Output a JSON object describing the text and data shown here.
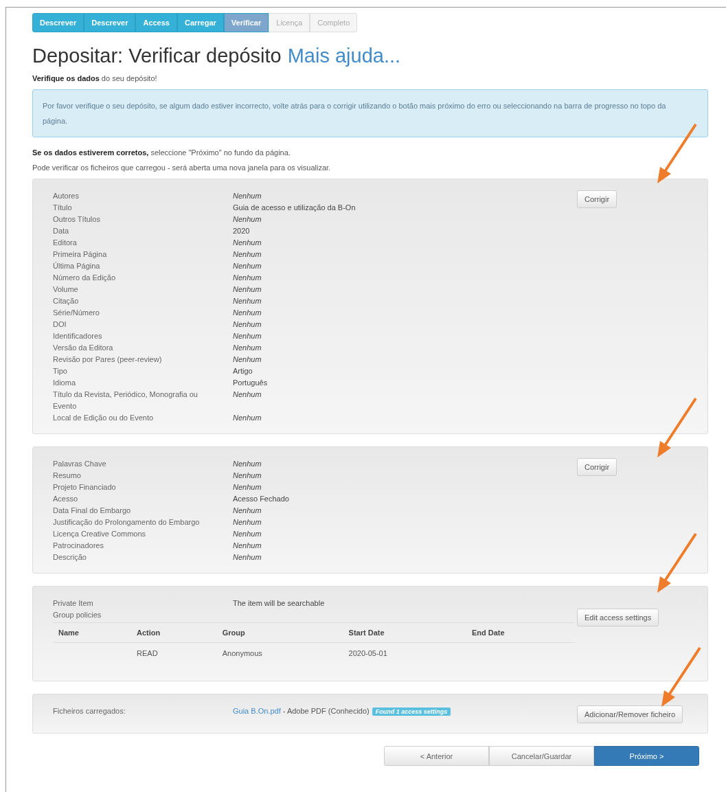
{
  "steps": [
    {
      "label": "Descrever",
      "selected": false,
      "disabled": false
    },
    {
      "label": "Descrever",
      "selected": false,
      "disabled": false
    },
    {
      "label": "Access",
      "selected": false,
      "disabled": false
    },
    {
      "label": "Carregar",
      "selected": false,
      "disabled": false
    },
    {
      "label": "Verificar",
      "selected": true,
      "disabled": false
    },
    {
      "label": "Licença",
      "selected": false,
      "disabled": true
    },
    {
      "label": "Completo",
      "selected": false,
      "disabled": true
    }
  ],
  "title": "Depositar: Verificar depósito",
  "help_link": "Mais ajuda...",
  "subtitle": "**Verifique os dados** do seu depósito!",
  "alert": "Por favor verifique o seu depósito, se algum dado estiver incorrecto, volte atrás para o corrigir utilizando o botão mais próximo do erro ou seleccionando na barra de progresso no topo da página.",
  "notes": [
    "**Se os dados estiverem corretos,** seleccione \"Próximo\" no fundo da página.",
    "Pode verificar os ficheiros que carregou - será aberta uma nova janela para os visualizar."
  ],
  "sections": [
    {
      "kind": "fields",
      "button": "Corrigir",
      "fields": [
        {
          "label": "Autores",
          "value": "Nenhum",
          "empty": true
        },
        {
          "label": "Título",
          "value": "Guia de acesso e utilização da B-On",
          "empty": false
        },
        {
          "label": "Outros Títulos",
          "value": "Nenhum",
          "empty": true
        },
        {
          "label": "Data",
          "value": "2020",
          "empty": false
        },
        {
          "label": "Editora",
          "value": "Nenhum",
          "empty": true
        },
        {
          "label": "Primeira Página",
          "value": "Nenhum",
          "empty": true
        },
        {
          "label": "Última Página",
          "value": "Nenhum",
          "empty": true
        },
        {
          "label": "Número da Edição",
          "value": "Nenhum",
          "empty": true
        },
        {
          "label": "Volume",
          "value": "Nenhum",
          "empty": true
        },
        {
          "label": "Citação",
          "value": "Nenhum",
          "empty": true
        },
        {
          "label": "Série/Número",
          "value": "Nenhum",
          "empty": true
        },
        {
          "label": "DOI",
          "value": "Nenhum",
          "empty": true
        },
        {
          "label": "Identificadores",
          "value": "Nenhum",
          "empty": true
        },
        {
          "label": "Versão da Editora",
          "value": "Nenhum",
          "empty": true
        },
        {
          "label": "Revisão por Pares (peer-review)",
          "value": "Nenhum",
          "empty": true
        },
        {
          "label": "Tipo",
          "value": "Artigo",
          "empty": false
        },
        {
          "label": "Idioma",
          "value": "Português",
          "empty": false
        },
        {
          "label": "Título da Revista, Periódico, Monografia ou Evento",
          "value": "Nenhum",
          "empty": true
        },
        {
          "label": "Local de Edição ou do Evento",
          "value": "Nenhum",
          "empty": true
        }
      ]
    },
    {
      "kind": "fields",
      "button": "Corrigir",
      "fields": [
        {
          "label": "Palavras Chave",
          "value": "Nenhum",
          "empty": true
        },
        {
          "label": "Resumo",
          "value": "Nenhum",
          "empty": true
        },
        {
          "label": "Projeto Financiado",
          "value": "Nenhum",
          "empty": true
        },
        {
          "label": "Acesso",
          "value": "Acesso Fechado",
          "empty": false
        },
        {
          "label": "Data Final do Embargo",
          "value": "Nenhum",
          "empty": true
        },
        {
          "label": "Justificação do Prolongamento do Embargo",
          "value": "Nenhum",
          "empty": true
        },
        {
          "label": "Licença Creative Commons",
          "value": "Nenhum",
          "empty": true
        },
        {
          "label": "Patrocinadores",
          "value": "Nenhum",
          "empty": true
        },
        {
          "label": "Descrição",
          "value": "Nenhum",
          "empty": true
        }
      ]
    },
    {
      "kind": "access",
      "button": "Edit access settings",
      "fields": [
        {
          "label": "Private Item",
          "value": "The item will be searchable",
          "empty": false
        }
      ],
      "policy_label": "Group policies",
      "columns": [
        "Name",
        "Action",
        "Group",
        "Start Date",
        "End Date"
      ],
      "rows": [
        [
          "",
          "READ",
          "Anonymous",
          "2020-05-01",
          ""
        ]
      ]
    },
    {
      "kind": "files",
      "button": "Adicionar/Remover ficheiro",
      "label": "Ficheiros carregados:",
      "file": "Guia B.On.pdf",
      "file_type": " - Adobe PDF (Conhecido)",
      "badge": "Found 1 access settings"
    }
  ],
  "footer": [
    {
      "label": "< Anterior",
      "primary": false
    },
    {
      "label": "Cancelar/Guardar",
      "primary": false
    },
    {
      "label": "Próximo >",
      "primary": true
    }
  ]
}
